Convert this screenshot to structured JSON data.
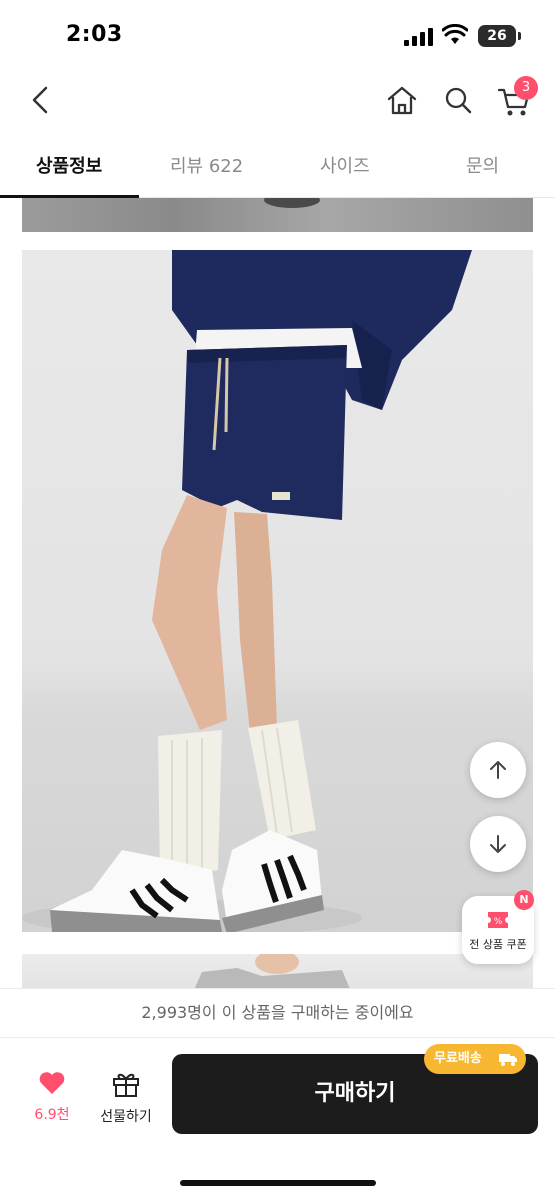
{
  "status_bar": {
    "time": "2:03",
    "battery": "26"
  },
  "header": {
    "cart_count": "3"
  },
  "tabs": [
    {
      "label": "상품정보",
      "active": true
    },
    {
      "label": "리뷰 622",
      "active": false
    },
    {
      "label": "사이즈",
      "active": false
    },
    {
      "label": "문의",
      "active": false
    }
  ],
  "icons": {
    "back": "chevron-left-icon",
    "home": "home-icon",
    "search": "search-icon",
    "cart": "cart-icon",
    "scroll_up": "arrow-up-icon",
    "scroll_down": "arrow-down-icon",
    "coupon": "coupon-icon",
    "like": "heart-icon",
    "gift": "gift-icon",
    "truck": "truck-icon"
  },
  "coupon": {
    "badge": "N",
    "label": "전 상품 쿠폰"
  },
  "purchase_note": "2,993명이 이 상품을 구매하는 중이에요",
  "bottom": {
    "like_count": "6.9천",
    "gift_label": "선물하기",
    "buy_label": "구매하기",
    "free_shipping": "무료배송"
  },
  "colors": {
    "accent": "#ff4f6d",
    "shipping": "#f7b731",
    "buy_button": "#1c1c1c"
  }
}
